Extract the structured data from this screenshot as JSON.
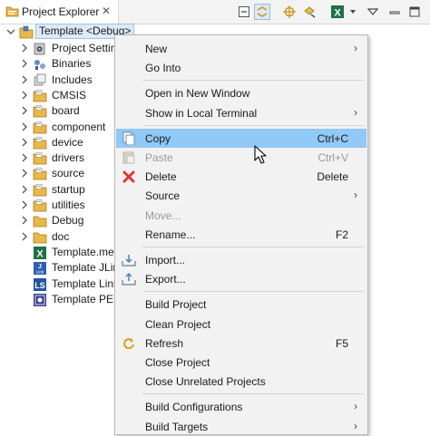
{
  "view": {
    "tab_label": "Project Explorer",
    "close_glyph": "✕",
    "toolbar_icons": [
      "collapse-all-icon",
      "link-with-editor-icon",
      "focus-icon",
      "sync-icon",
      "xl-icon",
      "view-menu-icon",
      "minimize-icon",
      "maximize-icon"
    ]
  },
  "tree": {
    "root": "Template <Debug>",
    "items": [
      {
        "label": "Project Settings",
        "icon": "settings-icon",
        "expandable": true
      },
      {
        "label": "Binaries",
        "icon": "binaries-icon",
        "expandable": true
      },
      {
        "label": "Includes",
        "icon": "includes-icon",
        "expandable": true
      },
      {
        "label": "CMSIS",
        "icon": "source-folder-icon",
        "expandable": true
      },
      {
        "label": "board",
        "icon": "source-folder-icon",
        "expandable": true
      },
      {
        "label": "component",
        "icon": "source-folder-icon",
        "expandable": true
      },
      {
        "label": "device",
        "icon": "source-folder-icon",
        "expandable": true
      },
      {
        "label": "drivers",
        "icon": "source-folder-icon",
        "expandable": true
      },
      {
        "label": "source",
        "icon": "source-folder-icon",
        "expandable": true
      },
      {
        "label": "startup",
        "icon": "source-folder-icon",
        "expandable": true
      },
      {
        "label": "utilities",
        "icon": "source-folder-icon",
        "expandable": true
      },
      {
        "label": "Debug",
        "icon": "folder-icon",
        "expandable": true
      },
      {
        "label": "doc",
        "icon": "folder-icon",
        "expandable": true
      },
      {
        "label": "Template.mex",
        "icon": "mex-file-icon",
        "expandable": false
      },
      {
        "label": "Template JLin",
        "icon": "jlink-launch-icon",
        "expandable": false
      },
      {
        "label": "Template Link",
        "icon": "linkserver-launch-icon",
        "expandable": false
      },
      {
        "label": "Template PE D",
        "icon": "pe-debug-launch-icon",
        "expandable": false
      }
    ]
  },
  "menu": {
    "items": [
      {
        "label": "New",
        "accel": "",
        "submenu": true
      },
      {
        "label": "Go Into",
        "accel": ""
      },
      {
        "sep": true
      },
      {
        "label": "Open in New Window",
        "accel": ""
      },
      {
        "label": "Show in Local Terminal",
        "accel": "",
        "submenu": true
      },
      {
        "sep": true
      },
      {
        "label": "Copy",
        "accel": "Ctrl+C",
        "icon": "copy-icon",
        "highlighted": true
      },
      {
        "label": "Paste",
        "accel": "Ctrl+V",
        "icon": "paste-icon",
        "disabled": true
      },
      {
        "label": "Delete",
        "accel": "Delete",
        "icon": "delete-icon"
      },
      {
        "label": "Source",
        "accel": "",
        "submenu": true
      },
      {
        "label": "Move...",
        "accel": "",
        "disabled": true
      },
      {
        "label": "Rename...",
        "accel": "F2"
      },
      {
        "sep": true
      },
      {
        "label": "Import...",
        "accel": "",
        "icon": "import-icon"
      },
      {
        "label": "Export...",
        "accel": "",
        "icon": "export-icon"
      },
      {
        "sep": true
      },
      {
        "label": "Build Project",
        "accel": ""
      },
      {
        "label": "Clean Project",
        "accel": ""
      },
      {
        "label": "Refresh",
        "accel": "F5",
        "icon": "refresh-icon"
      },
      {
        "label": "Close Project",
        "accel": ""
      },
      {
        "label": "Close Unrelated Projects",
        "accel": ""
      },
      {
        "sep": true
      },
      {
        "label": "Build Configurations",
        "accel": "",
        "submenu": true
      },
      {
        "label": "Build Targets",
        "accel": "",
        "submenu": true
      }
    ],
    "submenu_glyph": "›"
  },
  "colors": {
    "highlight": "#91c9f7",
    "folder": "#e8b84a",
    "delete": "#d63a2f",
    "excel_green": "#1e7145"
  }
}
